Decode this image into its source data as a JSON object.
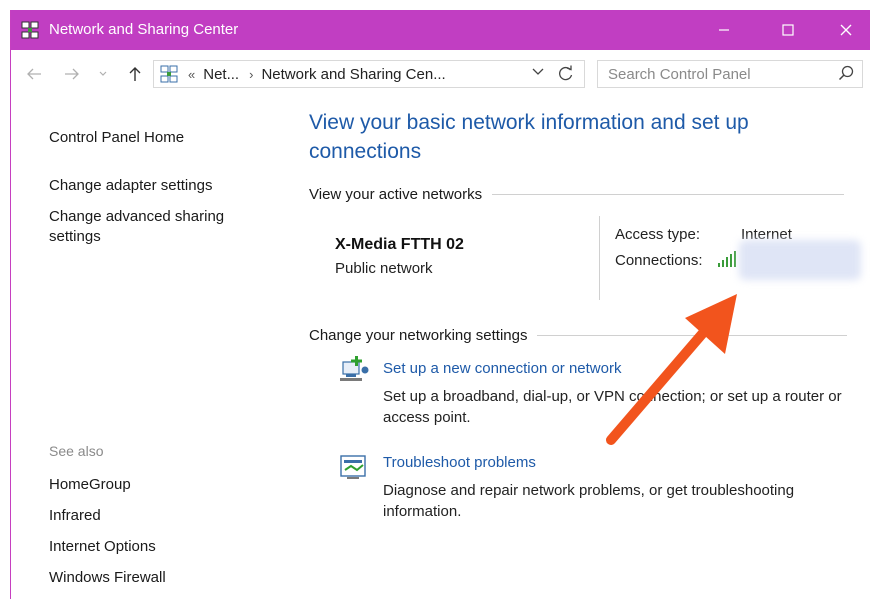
{
  "window": {
    "title": "Network and Sharing Center",
    "accent_color": "#c13ec2"
  },
  "address_bar": {
    "overflow": "«",
    "crumb_1": "Net...",
    "crumb_sep": "›",
    "crumb_2": "Network and Sharing Cen...",
    "search_placeholder": "Search Control Panel"
  },
  "left_pane": {
    "home": "Control Panel Home",
    "adapter": "Change adapter settings",
    "advanced_line1": "Change advanced sharing",
    "advanced_line2": "settings",
    "see_also": "See also",
    "links": [
      "HomeGroup",
      "Infrared",
      "Internet Options",
      "Windows Firewall"
    ]
  },
  "main": {
    "title": "View your basic network information and set up connections",
    "active_networks_heading": "View your active networks",
    "network_name": "X-Media FTTH 02",
    "network_type": "Public network",
    "access_type_label": "Access type:",
    "access_type_value": "Internet",
    "connections_label": "Connections:",
    "change_settings_heading": "Change your networking settings",
    "task1_link": "Set up a new connection or network",
    "task1_desc": "Set up a broadband, dial-up, or VPN connection; or set up a router or access point.",
    "task2_link": "Troubleshoot problems",
    "task2_desc": "Diagnose and repair network problems, or get troubleshooting information."
  },
  "icons": {
    "app": "network-icon",
    "signal": "wifi-signal-icon",
    "task1": "new-connection-icon",
    "task2": "troubleshoot-icon",
    "annotation_color": "#f2541d"
  }
}
